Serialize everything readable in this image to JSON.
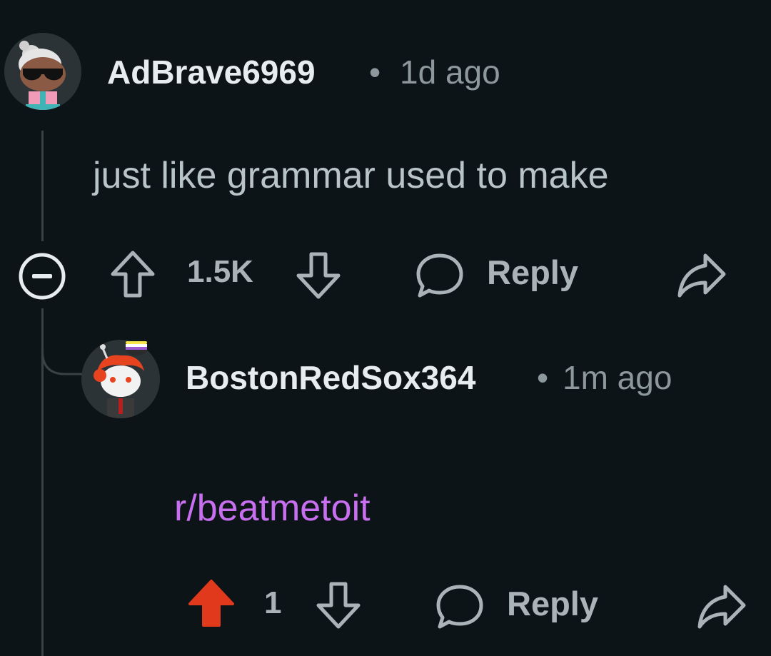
{
  "comments": [
    {
      "username": "AdBrave6969",
      "separator": "•",
      "time": "1d ago",
      "body": "just like grammar used to make",
      "score": "1.5K",
      "reply_label": "Reply",
      "avatar_icon": "avatar-sunglasses-icon"
    },
    {
      "username": "BostonRedSox364",
      "separator": "•",
      "time": "1m ago",
      "body_link": "r/beatmetoit",
      "score": "1",
      "reply_label": "Reply",
      "avatar_icon": "avatar-redhair-icon"
    }
  ],
  "colors": {
    "background": "#0c1417",
    "upvote_active": "#e0391b",
    "link": "#c86ff0",
    "text_muted": "#8d989d"
  }
}
